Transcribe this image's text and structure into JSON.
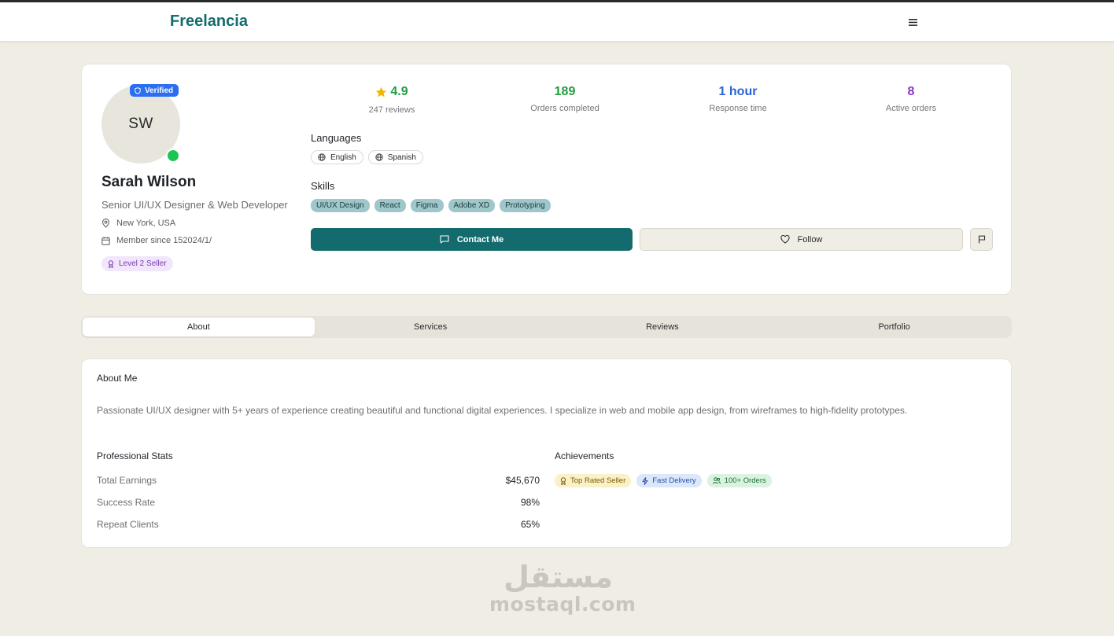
{
  "navbar": {
    "brand": "Freelancia",
    "menu_icon": "hamburger-icon"
  },
  "profile": {
    "initials": "SW",
    "verified_label": "Verified",
    "name": "Sarah Wilson",
    "title": "Senior UI/UX Designer & Web Developer",
    "location": "New York, USA",
    "member_since": "Member since 152024/1/",
    "level": "Level 2 Seller",
    "online": true
  },
  "stats": [
    {
      "value": "4.9",
      "label": "247 reviews",
      "color": "#1f9e3e",
      "icon": "star-icon"
    },
    {
      "value": "189",
      "label": "Orders completed",
      "color": "#1f9e3e"
    },
    {
      "value": "1 hour",
      "label": "Response time",
      "color": "#2b63d6"
    },
    {
      "value": "8",
      "label": "Active orders",
      "color": "#8a35c7"
    }
  ],
  "languages": {
    "heading": "Languages",
    "items": [
      "English",
      "Spanish"
    ]
  },
  "skills": {
    "heading": "Skills",
    "items": [
      "UI/UX Design",
      "React",
      "Figma",
      "Adobe XD",
      "Prototyping"
    ]
  },
  "actions": {
    "contact": "Contact Me",
    "follow": "Follow"
  },
  "tabs": [
    "About",
    "Services",
    "Reviews",
    "Portfolio"
  ],
  "active_tab": "About",
  "about": {
    "title": "About Me",
    "bio": "Passionate UI/UX designer with 5+ years of experience creating beautiful and functional digital experiences. I specialize in web and mobile app design, from wireframes to high-fidelity prototypes.",
    "stats_heading": "Professional Stats",
    "stats": [
      {
        "label": "Total Earnings",
        "value": "$45,670"
      },
      {
        "label": "Success Rate",
        "value": "98%"
      },
      {
        "label": "Repeat Clients",
        "value": "65%"
      }
    ],
    "achievements_heading": "Achievements",
    "achievements": [
      {
        "label": "Top Rated Seller",
        "bg": "#fbf1c8",
        "fg": "#7a5a00"
      },
      {
        "label": "Fast Delivery",
        "bg": "#dbe7fb",
        "fg": "#2a4f9e"
      },
      {
        "label": "100+ Orders",
        "bg": "#daf3e0",
        "fg": "#1f6b36"
      }
    ]
  },
  "watermark": {
    "arabic": "مستقل",
    "latin": "mostaql.com"
  },
  "colors": {
    "brand": "#136d6d",
    "background": "#f0ede5",
    "primary_button": "#146b6d",
    "verified": "#2b6ef2",
    "online": "#1cc552"
  }
}
